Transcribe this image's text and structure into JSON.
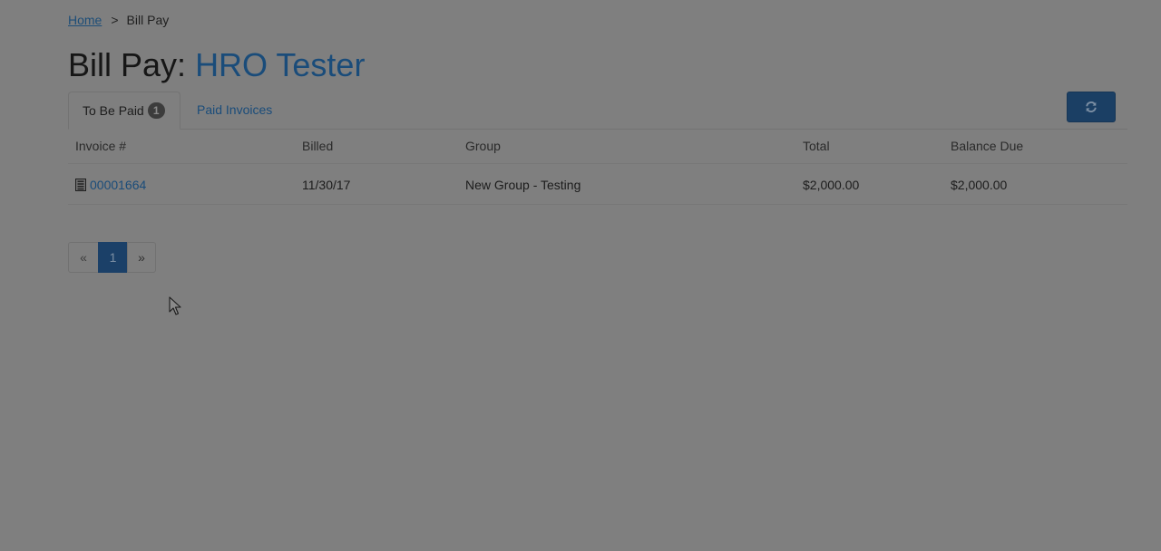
{
  "breadcrumb": {
    "home_label": "Home",
    "separator": ">",
    "current_label": "Bill Pay"
  },
  "header": {
    "title_prefix": "Bill Pay:",
    "title_name": "HRO Tester"
  },
  "tabs": [
    {
      "label": "To Be Paid",
      "badge": "1",
      "active": true
    },
    {
      "label": "Paid Invoices",
      "active": false
    }
  ],
  "toolbar": {
    "refresh_icon": "refresh-icon"
  },
  "table": {
    "columns": [
      "Invoice #",
      "Billed",
      "Group",
      "Total",
      "Balance Due"
    ],
    "rows": [
      {
        "invoice": "00001664",
        "billed": "11/30/17",
        "group": "New Group - Testing",
        "total": "$2,000.00",
        "balance_due": "$2,000.00"
      }
    ]
  },
  "pagination": {
    "prev_label": "«",
    "current_page": "1",
    "next_label": "»"
  },
  "colors": {
    "overlay_background": "#7f7f7f",
    "link": "#1a4c7a",
    "primary_button": "#1b3f64"
  }
}
